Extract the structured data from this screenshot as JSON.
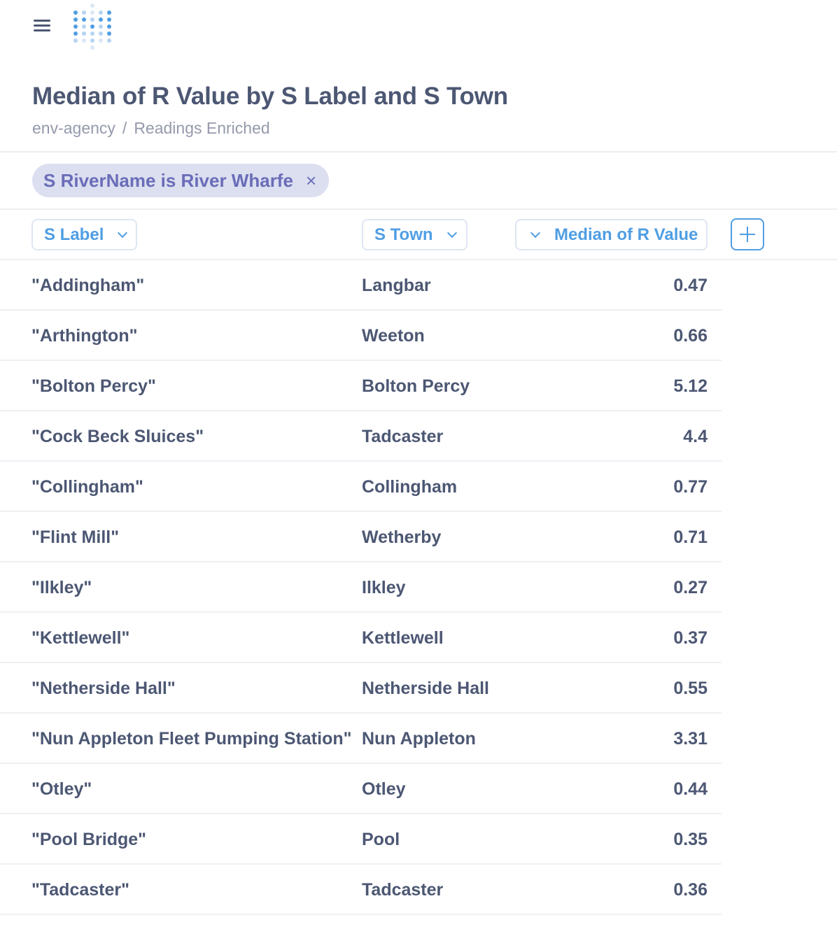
{
  "page": {
    "title": "Median of R Value by S Label and S Town",
    "breadcrumb": [
      "env-agency",
      "Readings Enriched"
    ],
    "breadcrumb_separator": "/"
  },
  "filter": {
    "label": "S RiverName is River Wharfe",
    "remove_label": "×"
  },
  "columns": {
    "label": "S Label",
    "town": "S Town",
    "value": "Median of R Value"
  },
  "rows": [
    {
      "label": "\"Addingham\"",
      "town": "Langbar",
      "value": "0.47"
    },
    {
      "label": "\"Arthington\"",
      "town": "Weeton",
      "value": "0.66"
    },
    {
      "label": "\"Bolton Percy\"",
      "town": "Bolton Percy",
      "value": "5.12"
    },
    {
      "label": "\"Cock Beck Sluices\"",
      "town": "Tadcaster",
      "value": "4.4"
    },
    {
      "label": "\"Collingham\"",
      "town": "Collingham",
      "value": "0.77"
    },
    {
      "label": "\"Flint Mill\"",
      "town": "Wetherby",
      "value": "0.71"
    },
    {
      "label": "\"Ilkley\"",
      "town": "Ilkley",
      "value": "0.27"
    },
    {
      "label": "\"Kettlewell\"",
      "town": "Kettlewell",
      "value": "0.37"
    },
    {
      "label": "\"Netherside Hall\"",
      "town": "Netherside Hall",
      "value": "0.55"
    },
    {
      "label": "\"Nun Appleton Fleet Pumping Station\"",
      "town": "Nun Appleton",
      "value": "3.31"
    },
    {
      "label": "\"Otley\"",
      "town": "Otley",
      "value": "0.44"
    },
    {
      "label": "\"Pool Bridge\"",
      "town": "Pool",
      "value": "0.35"
    },
    {
      "label": "\"Tadcaster\"",
      "town": "Tadcaster",
      "value": "0.36"
    }
  ],
  "colors": {
    "accent": "#509ee3",
    "filter_bg": "#dcdff0",
    "filter_text": "#6a6db8",
    "text": "#4c5773",
    "muted": "#949aab"
  }
}
